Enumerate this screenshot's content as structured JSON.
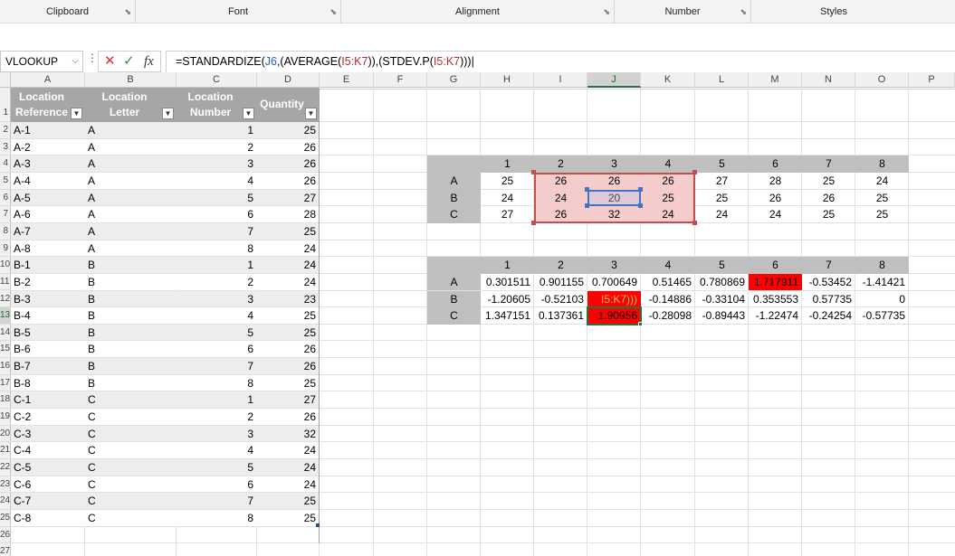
{
  "ribbon": {
    "groups": [
      "Clipboard",
      "Font",
      "Alignment",
      "Number",
      "Styles"
    ]
  },
  "formula_bar": {
    "name_box": "VLOOKUP",
    "fx_label": "fx",
    "cancel_icon": "cross-icon",
    "enter_icon": "check-icon",
    "formula": {
      "p1": "=STANDARDIZE(",
      "r1": "J6",
      "p2": ",(AVERAGE(",
      "r2": "I5:K7",
      "p3": ")),(STDEV.P(",
      "r3": "I5:K7",
      "p4": ")))"
    }
  },
  "columns": [
    "A",
    "B",
    "C",
    "D",
    "E",
    "F",
    "G",
    "H",
    "I",
    "J",
    "K",
    "L",
    "M",
    "N",
    "O",
    "P"
  ],
  "active_column": "J",
  "active_row": "13",
  "row_numbers": [
    "1",
    "2",
    "3",
    "4",
    "5",
    "6",
    "7",
    "8",
    "9",
    "10",
    "11",
    "12",
    "13",
    "14",
    "15",
    "16",
    "17",
    "18",
    "19",
    "20",
    "21",
    "22",
    "23",
    "24",
    "25",
    "26",
    "27"
  ],
  "table": {
    "headers": [
      "Location Reference",
      "Location Letter Reference",
      "Location Number",
      "Quantity"
    ],
    "rows": [
      [
        "A-1",
        "A",
        "1",
        "25"
      ],
      [
        "A-2",
        "A",
        "2",
        "26"
      ],
      [
        "A-3",
        "A",
        "3",
        "26"
      ],
      [
        "A-4",
        "A",
        "4",
        "26"
      ],
      [
        "A-5",
        "A",
        "5",
        "27"
      ],
      [
        "A-6",
        "A",
        "6",
        "28"
      ],
      [
        "A-7",
        "A",
        "7",
        "25"
      ],
      [
        "A-8",
        "A",
        "8",
        "24"
      ],
      [
        "B-1",
        "B",
        "1",
        "24"
      ],
      [
        "B-2",
        "B",
        "2",
        "24"
      ],
      [
        "B-3",
        "B",
        "3",
        "23"
      ],
      [
        "B-4",
        "B",
        "4",
        "25"
      ],
      [
        "B-5",
        "B",
        "5",
        "25"
      ],
      [
        "B-6",
        "B",
        "6",
        "26"
      ],
      [
        "B-7",
        "B",
        "7",
        "26"
      ],
      [
        "B-8",
        "B",
        "8",
        "25"
      ],
      [
        "C-1",
        "C",
        "1",
        "27"
      ],
      [
        "C-2",
        "C",
        "2",
        "26"
      ],
      [
        "C-3",
        "C",
        "3",
        "32"
      ],
      [
        "C-4",
        "C",
        "4",
        "24"
      ],
      [
        "C-5",
        "C",
        "5",
        "24"
      ],
      [
        "C-6",
        "C",
        "6",
        "24"
      ],
      [
        "C-7",
        "C",
        "7",
        "25"
      ],
      [
        "C-8",
        "C",
        "8",
        "25"
      ]
    ]
  },
  "matrix1": {
    "cols": [
      "1",
      "2",
      "3",
      "4",
      "5",
      "6",
      "7",
      "8"
    ],
    "rows": [
      {
        "label": "A",
        "values": [
          "25",
          "26",
          "26",
          "26",
          "27",
          "28",
          "25",
          "24"
        ]
      },
      {
        "label": "B",
        "values": [
          "24",
          "24",
          "20",
          "25",
          "25",
          "26",
          "26",
          "25"
        ]
      },
      {
        "label": "C",
        "values": [
          "27",
          "26",
          "32",
          "24",
          "24",
          "24",
          "25",
          "25"
        ]
      }
    ]
  },
  "matrix2": {
    "cols": [
      "1",
      "2",
      "3",
      "4",
      "5",
      "6",
      "7",
      "8"
    ],
    "rows": [
      {
        "label": "A",
        "values": [
          "0.301511",
          "0.901155",
          "0.700649",
          "0.51465",
          "0.780869",
          "1.717911",
          "-0.53452",
          "-1.41421"
        ]
      },
      {
        "label": "B",
        "values": [
          "-1.20605",
          "-0.52103",
          "I5:K7)))",
          "-0.14886",
          "-0.33104",
          "0.353553",
          "0.57735",
          "0"
        ]
      },
      {
        "label": "C",
        "values": [
          "1.347151",
          "0.137361",
          "1.90956",
          "-0.28098",
          "-0.89443",
          "-1.22474",
          "-0.24254",
          "-0.57735"
        ]
      }
    ]
  },
  "colors": {
    "highlight_red": "#ff0000",
    "range_fill": "#f4cccc",
    "range_border": "#c0504d",
    "selection_blue": "#4472c4",
    "excel_green": "#217346"
  }
}
